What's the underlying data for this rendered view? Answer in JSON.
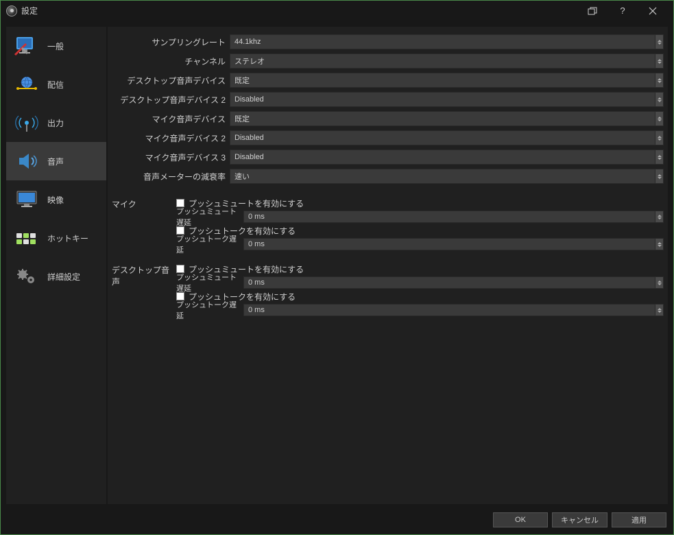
{
  "window": {
    "title": "設定"
  },
  "sidebar": {
    "general": "一般",
    "stream": "配信",
    "output": "出力",
    "audio": "音声",
    "video": "映像",
    "hotkeys": "ホットキー",
    "advanced": "詳細設定"
  },
  "form": {
    "sample_rate_label": "サンプリングレート",
    "sample_rate_value": "44.1khz",
    "channels_label": "チャンネル",
    "channels_value": "ステレオ",
    "desktop_audio_label": "デスクトップ音声デバイス",
    "desktop_audio_value": "既定",
    "desktop_audio2_label": "デスクトップ音声デバイス 2",
    "desktop_audio2_value": "Disabled",
    "mic_audio_label": "マイク音声デバイス",
    "mic_audio_value": "既定",
    "mic_audio2_label": "マイク音声デバイス 2",
    "mic_audio2_value": "Disabled",
    "mic_audio3_label": "マイク音声デバイス 3",
    "mic_audio3_value": "Disabled",
    "decay_label": "音声メーターの減衰率",
    "decay_value": "速い"
  },
  "sections": {
    "mic_label": "マイク",
    "desktop_label": "デスクトップ音声",
    "push_mute_enable": "プッシュミュートを有効にする",
    "push_mute_delay_label": "プッシュミュート遅延",
    "push_talk_enable": "プッシュトークを有効にする",
    "push_talk_delay_label": "プッシュトーク遅延",
    "delay_value": "0 ms"
  },
  "footer": {
    "ok": "OK",
    "cancel": "キャンセル",
    "apply": "適用"
  }
}
